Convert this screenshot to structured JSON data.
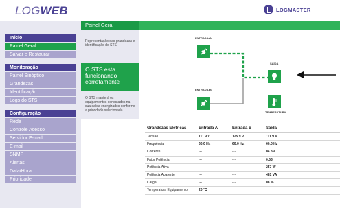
{
  "header": {
    "logo_log": "LOG",
    "logo_web": "WEB",
    "brand": "LOGMASTER"
  },
  "sidebar": {
    "groups": [
      {
        "title": "Início",
        "items": [
          "Painel Geral",
          "Salvar e Restaurar"
        ]
      },
      {
        "title": "Monitoração",
        "items": [
          "Painel Sinóptico",
          "Grandezas",
          "Identificação",
          "Logs do STS"
        ]
      },
      {
        "title": "Configuração",
        "items": [
          "Rede",
          "Controle Acesso",
          "Servidor E-mail",
          "E-mail",
          "SNMP",
          "Alertas",
          "Data/Hora",
          "Prioridade"
        ]
      }
    ],
    "active_item": "Painel Geral"
  },
  "main": {
    "title": "Painel Geral",
    "description": "Representação das grandezas e identificação do STS",
    "status": "O STS esta funcionando corretamente",
    "note": "O STS manterá os equipamentos conectados na sua saída energizados conforme a prioridade selecionada"
  },
  "diagram": {
    "entrada_a": "ENTRADA-A",
    "entrada_b": "ENTRADA-B",
    "saida": "SAÍDA",
    "temperatura": "TEMPERATURA",
    "icons": [
      "plug-icon",
      "plug-icon",
      "bulb-icon",
      "thermometer-icon",
      "arrow-left-icon"
    ],
    "colors": {
      "green": "#1fa24b",
      "active_line": "#1fa24b",
      "inactive_line": "#9a9a9a",
      "accent": "#4a4194"
    }
  },
  "table": {
    "headers": [
      "Grandezas Elétricas",
      "Entrada A",
      "Entrada B",
      "Saída"
    ],
    "rows": [
      [
        "Tensão",
        "111.9 V",
        "125.9 V",
        "111.9 V"
      ],
      [
        "Frequência",
        "60.0 Hz",
        "60.0 Hz",
        "60.0 Hz"
      ],
      [
        "Corrente",
        "---",
        "---",
        "04.3 A"
      ],
      [
        "Fator Potência",
        "---",
        "---",
        "0.53"
      ],
      [
        "Potência Ativa",
        "---",
        "---",
        "257 W"
      ],
      [
        "Potência Aparente",
        "---",
        "---",
        "481 VA"
      ],
      [
        "Carga",
        "---",
        "---",
        "08 %"
      ],
      [
        "Temperatura Equipamento",
        "20 °C",
        "",
        ""
      ]
    ]
  }
}
